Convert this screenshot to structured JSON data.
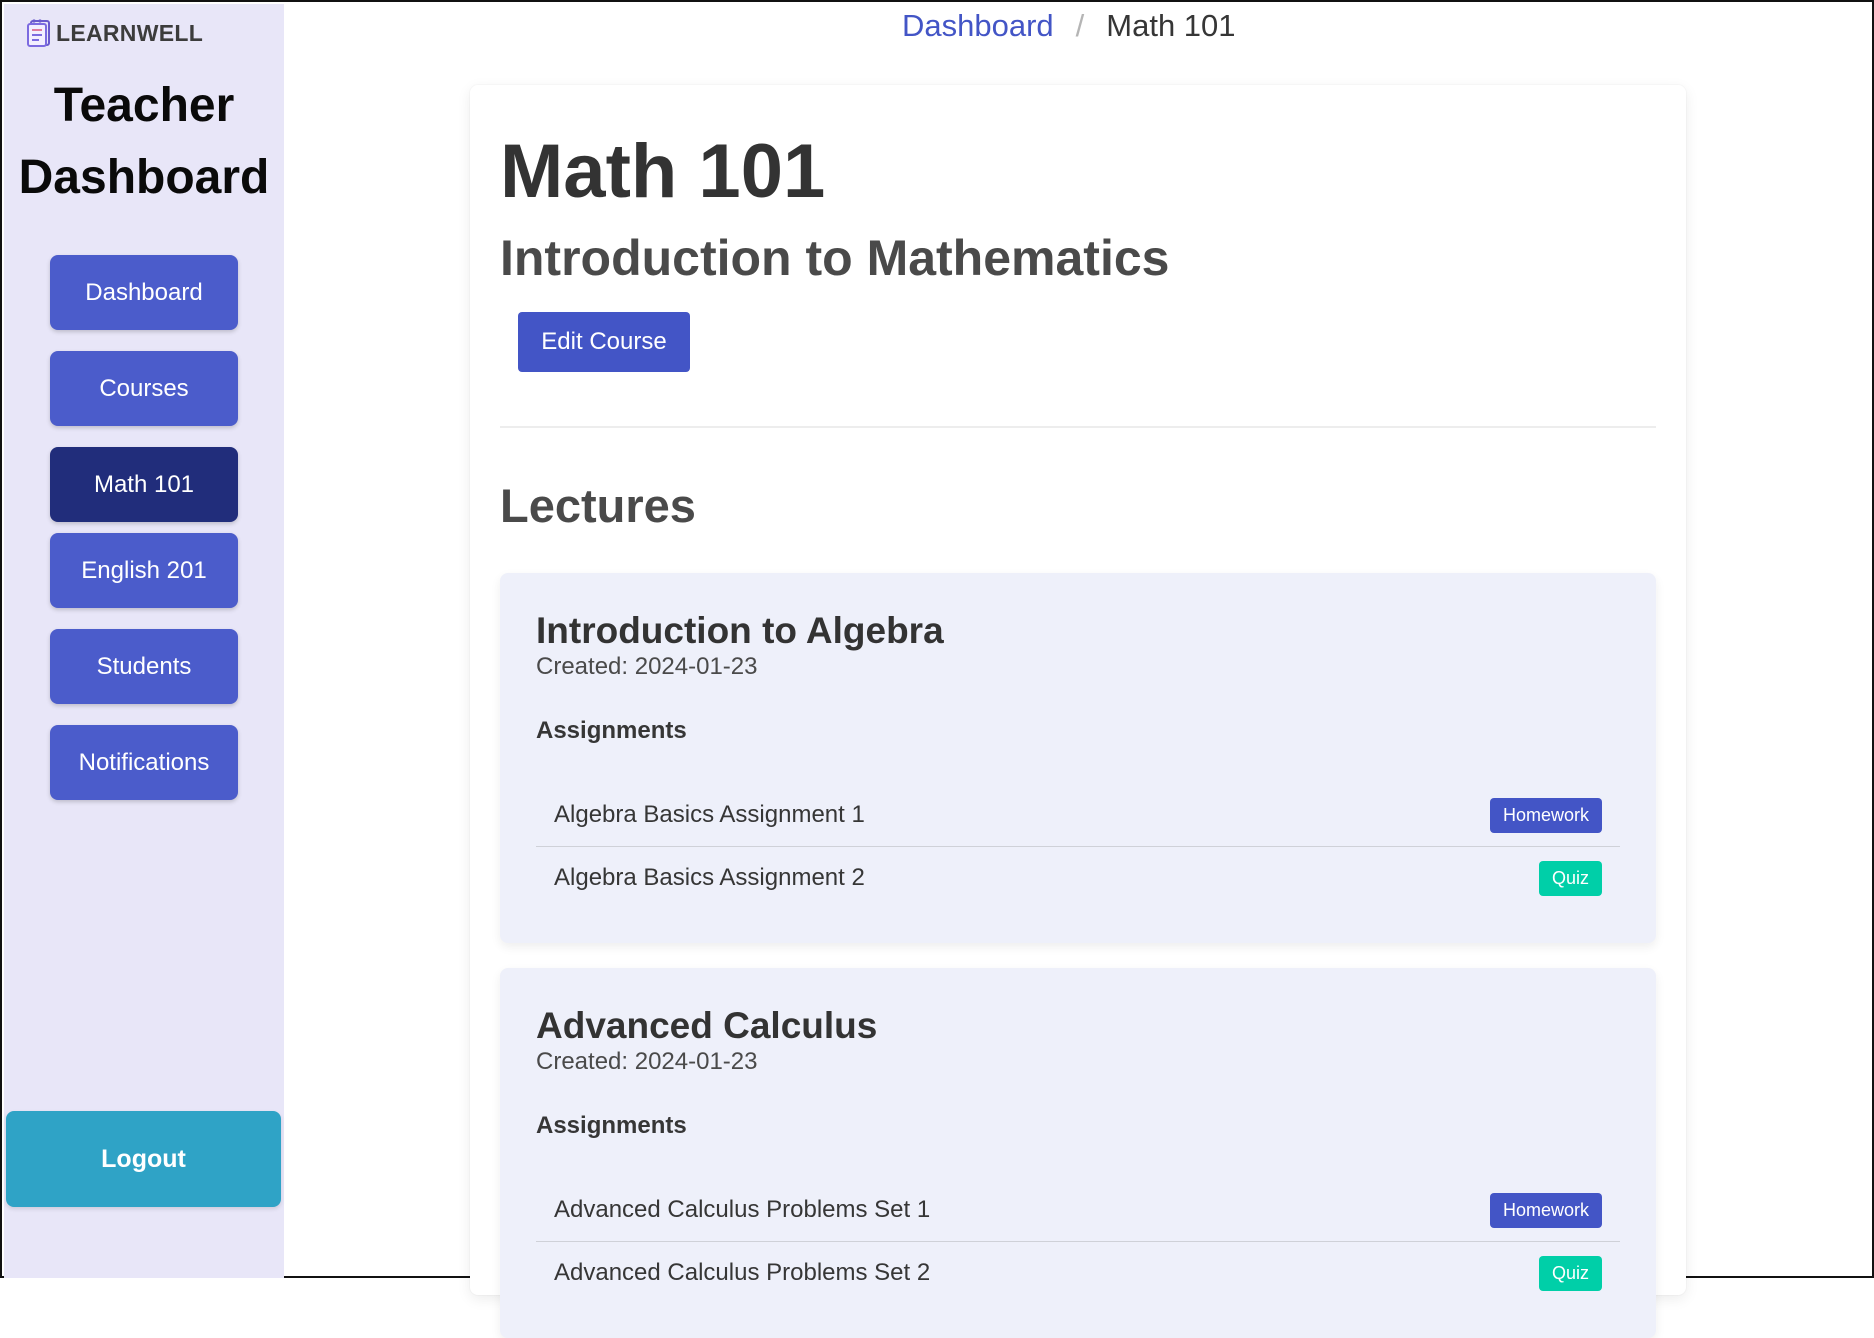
{
  "brand": {
    "name": "LEARNWELL",
    "icon": "notebook-icon"
  },
  "sidebar": {
    "title_line1": "Teacher",
    "title_line2": "Dashboard",
    "items": [
      {
        "label": "Dashboard",
        "active": false
      },
      {
        "label": "Courses",
        "active": false
      },
      {
        "label": "Math 101",
        "active": true
      },
      {
        "label": "English 201",
        "active": false
      },
      {
        "label": "Students",
        "active": false
      },
      {
        "label": "Notifications",
        "active": false
      }
    ],
    "logout_label": "Logout"
  },
  "breadcrumb": {
    "items": [
      {
        "label": "Dashboard"
      },
      {
        "label": "Math 101"
      }
    ],
    "separator": "/"
  },
  "course": {
    "title": "Math 101",
    "subtitle": "Introduction to Mathematics",
    "edit_label": "Edit Course"
  },
  "lectures_heading": "Lectures",
  "lectures": [
    {
      "title": "Introduction to Algebra",
      "created": "Created: 2024-01-23",
      "assignments_heading": "Assignments",
      "assignments": [
        {
          "name": "Algebra Basics Assignment 1",
          "tag": "Homework"
        },
        {
          "name": "Algebra Basics Assignment 2",
          "tag": "Quiz"
        }
      ]
    },
    {
      "title": "Advanced Calculus",
      "created": "Created: 2024-01-23",
      "assignments_heading": "Assignments",
      "assignments": [
        {
          "name": "Advanced Calculus Problems Set 1",
          "tag": "Homework"
        },
        {
          "name": "Advanced Calculus Problems Set 2",
          "tag": "Quiz"
        }
      ]
    }
  ],
  "colors": {
    "primary": "#4355c6",
    "nav_active": "#212d7b",
    "sidebar_bg": "#e8e6f8",
    "logout": "#2fa3c6",
    "quiz_tag": "#00cfa8",
    "lecture_bg": "#eef0fa"
  }
}
